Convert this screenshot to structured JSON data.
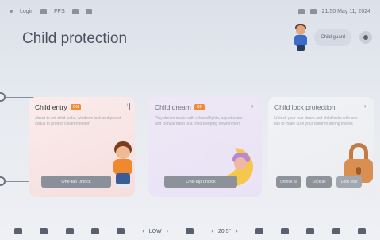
{
  "status_bar": {
    "left_text": "Login",
    "left_secondary": "FPS",
    "right_text": "21:50 May 11, 2024"
  },
  "page": {
    "title": "Child protection"
  },
  "header": {
    "guard_button_label": "Child guard"
  },
  "cards": [
    {
      "title": "Child entry",
      "badge": "ON",
      "description": "About to set child locks, windows lock and preset status to protect children better",
      "button_label": "One-tap unlock"
    },
    {
      "title": "Child dream",
      "badge": "ON",
      "description": "Play dream music with relaxed lights, adjust seats and climate fitted to a child sleeping environment",
      "button_label": "One-tap unlock"
    },
    {
      "title": "Child lock protection",
      "description": "Unlock your rear doors and child locks with one tap to make sure your children during travels",
      "lock_buttons": [
        "Unlock all",
        "Lock all",
        "Lock rear"
      ]
    }
  ],
  "dock": {
    "climate_mode": "LOW",
    "temperature": "20.5°"
  },
  "colors": {
    "badge": "#f08a3c",
    "button": "#8a9099",
    "title": "#4a5360"
  }
}
